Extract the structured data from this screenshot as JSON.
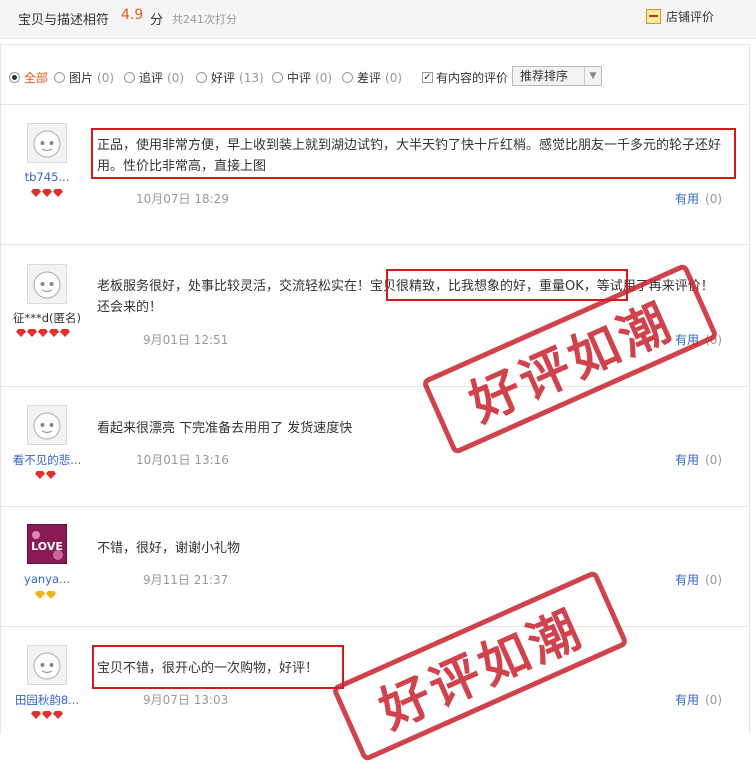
{
  "header": {
    "rating_label": "宝贝与描述相符",
    "rating_score": "4.9",
    "rating_unit": "分",
    "rating_count": "共241次打分",
    "shop_review_label": "店铺评价"
  },
  "filters": {
    "options": [
      {
        "label": "全部",
        "count": "",
        "selected": true
      },
      {
        "label": "图片",
        "count": "(0)",
        "selected": false
      },
      {
        "label": "追评",
        "count": "(0)",
        "selected": false
      },
      {
        "label": "好评",
        "count": "(13)",
        "selected": false
      },
      {
        "label": "中评",
        "count": "(0)",
        "selected": false
      },
      {
        "label": "差评",
        "count": "(0)",
        "selected": false
      }
    ],
    "content_only_label": "有内容的评价",
    "content_only_checked": "✓",
    "sort_label": "推荐排序",
    "sort_arrow": "▼"
  },
  "reviews": [
    {
      "user": "tb745...",
      "avatar": "default",
      "gems": 3,
      "gem_color": "red",
      "text": "正品，使用非常方便，早上收到装上就到湖边试钓，大半天钓了快十斤红梢。感觉比朋友一千多元的轮子还好用。性价比非常高，直接上图",
      "date": "10月07日 18:29",
      "useful": "有用",
      "useful_count": "(0)"
    },
    {
      "user": "征***d(匿名)",
      "avatar": "default",
      "gems": 5,
      "gem_color": "red",
      "text": "老板服务很好，处事比较灵活，交流轻松实在！宝贝很精致，比我想象的好，重量OK，等试用了再来评价！还会来的！",
      "date": "9月01日 12:51",
      "useful": "有用",
      "useful_count": "(0)"
    },
    {
      "user": "看不见的悲...",
      "avatar": "default",
      "gems": 2,
      "gem_color": "red",
      "text": "看起来很漂亮 下完准备去用用了 发货速度快",
      "date": "10月01日 13:16",
      "useful": "有用",
      "useful_count": "(0)"
    },
    {
      "user": "yanya...",
      "avatar": "photo",
      "avatar_text": "LOVE",
      "gems": 2,
      "gem_color": "gold",
      "text": "不错，很好，谢谢小礼物",
      "date": "9月11日 21:37",
      "useful": "有用",
      "useful_count": "(0)"
    },
    {
      "user": "田园秋韵8...",
      "avatar": "default",
      "gems": 3,
      "gem_color": "red",
      "text": "宝贝不错，很开心的一次购物，好评！",
      "date": "9月07日 13:03",
      "useful": "有用",
      "useful_count": "(0)"
    }
  ],
  "stamps": {
    "text": "好评如潮"
  },
  "colors": {
    "accent": "#e8581c",
    "link": "#3366cc",
    "highlight": "#d51a1a",
    "stamp": "#c8232e"
  }
}
